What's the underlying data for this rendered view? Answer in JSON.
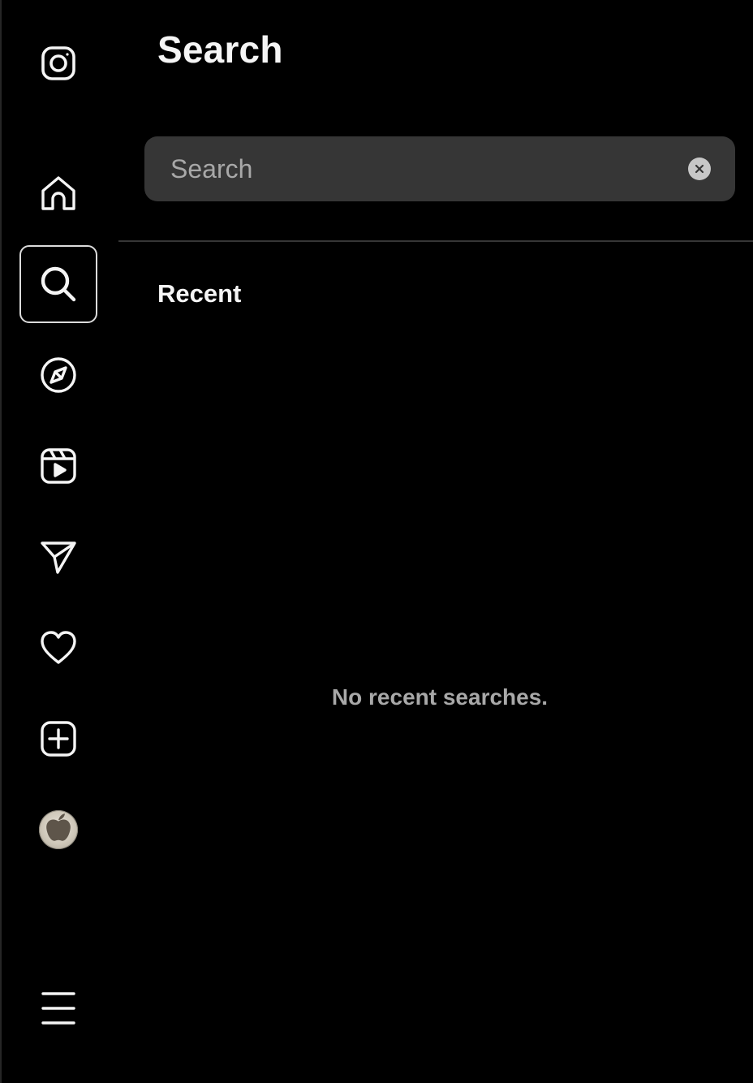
{
  "panel": {
    "title": "Search",
    "search": {
      "value": "",
      "placeholder": "Search"
    },
    "recent_heading": "Recent",
    "empty_message": "No recent searches."
  },
  "nav": {
    "active_item": "search",
    "items": [
      {
        "id": "instagram",
        "icon": "instagram-logo-icon"
      },
      {
        "id": "home",
        "icon": "home-icon"
      },
      {
        "id": "search",
        "icon": "search-icon"
      },
      {
        "id": "explore",
        "icon": "compass-icon"
      },
      {
        "id": "reels",
        "icon": "reels-icon"
      },
      {
        "id": "messages",
        "icon": "send-icon"
      },
      {
        "id": "notifications",
        "icon": "heart-icon"
      },
      {
        "id": "create",
        "icon": "plus-square-icon"
      },
      {
        "id": "profile",
        "icon": "avatar"
      },
      {
        "id": "more",
        "icon": "menu-icon"
      }
    ]
  },
  "colors": {
    "background": "#000000",
    "text": "#f5f5f5",
    "muted_text": "#a8a8a8",
    "search_fill": "#363636",
    "divider": "#363636",
    "active_border": "#dbdbdb"
  }
}
